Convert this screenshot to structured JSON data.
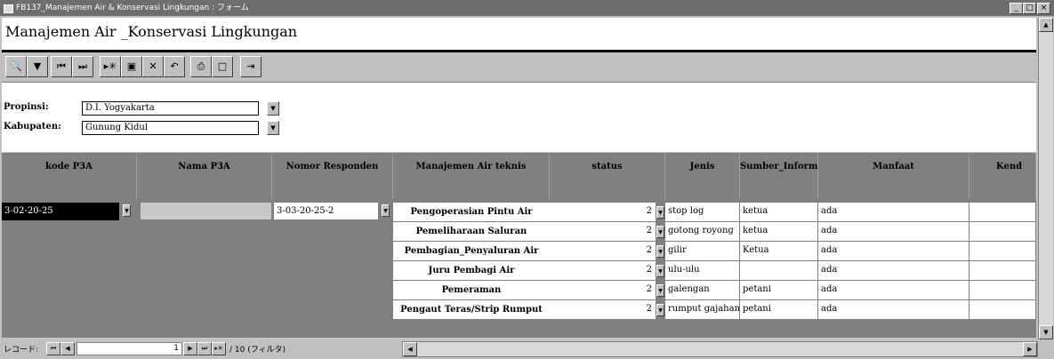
{
  "window": {
    "title": "FB137_Manajemen Air & Konservasi Lingkungan : フォーム"
  },
  "form": {
    "title": "Manajemen Air _Konservasi Lingkungan"
  },
  "toolbar": {
    "icons": [
      "binoculars-icon",
      "filter-icon",
      "first-record-icon",
      "last-record-icon",
      "new-record-icon",
      "save-icon",
      "delete-icon",
      "undo-icon",
      "print-icon",
      "print-preview-icon",
      "exit-icon"
    ]
  },
  "filter": {
    "propinsi_label": "Propinsi:",
    "propinsi_value": "D.I. Yogyakarta",
    "kabupaten_label": "Kabupaten:",
    "kabupaten_value": "Gunung Kidul"
  },
  "grid": {
    "headers": [
      "kode P3A",
      "Nama P3A",
      "Nomor Responden",
      "Manajemen Air teknis",
      "status",
      "Jenis",
      "Sumber_Informasi",
      "Manfaat",
      "Kend"
    ],
    "left": {
      "kode": "3-02-20-25",
      "nama": "",
      "responden": "3-03-20-25-2"
    },
    "rows": [
      {
        "manajemen": "Pengoperasian Pintu Air",
        "status": "2",
        "jenis": "stop log",
        "sumber": "ketua",
        "manfaat": "ada"
      },
      {
        "manajemen": "Pemeliharaan Saluran",
        "status": "2",
        "jenis": "gotong royong",
        "sumber": "ketua",
        "manfaat": "ada"
      },
      {
        "manajemen": "Pembagian_Penyaluran Air",
        "status": "2",
        "jenis": "gilir",
        "sumber": "Ketua",
        "manfaat": "ada"
      },
      {
        "manajemen": "Juru Pembagi Air",
        "status": "2",
        "jenis": "ulu-ulu",
        "sumber": "",
        "manfaat": "ada"
      },
      {
        "manajemen": "Pemeraman",
        "status": "2",
        "jenis": "galengan",
        "sumber": "petani",
        "manfaat": "ada"
      },
      {
        "manajemen": "Pengaut Teras/Strip Rumput",
        "status": "2",
        "jenis": "rumput gajahan",
        "sumber": "petani",
        "manfaat": "ada"
      }
    ]
  },
  "recnav": {
    "label": "レコード:",
    "current": "1",
    "total_text": "/ 10 (フィルタ)"
  }
}
